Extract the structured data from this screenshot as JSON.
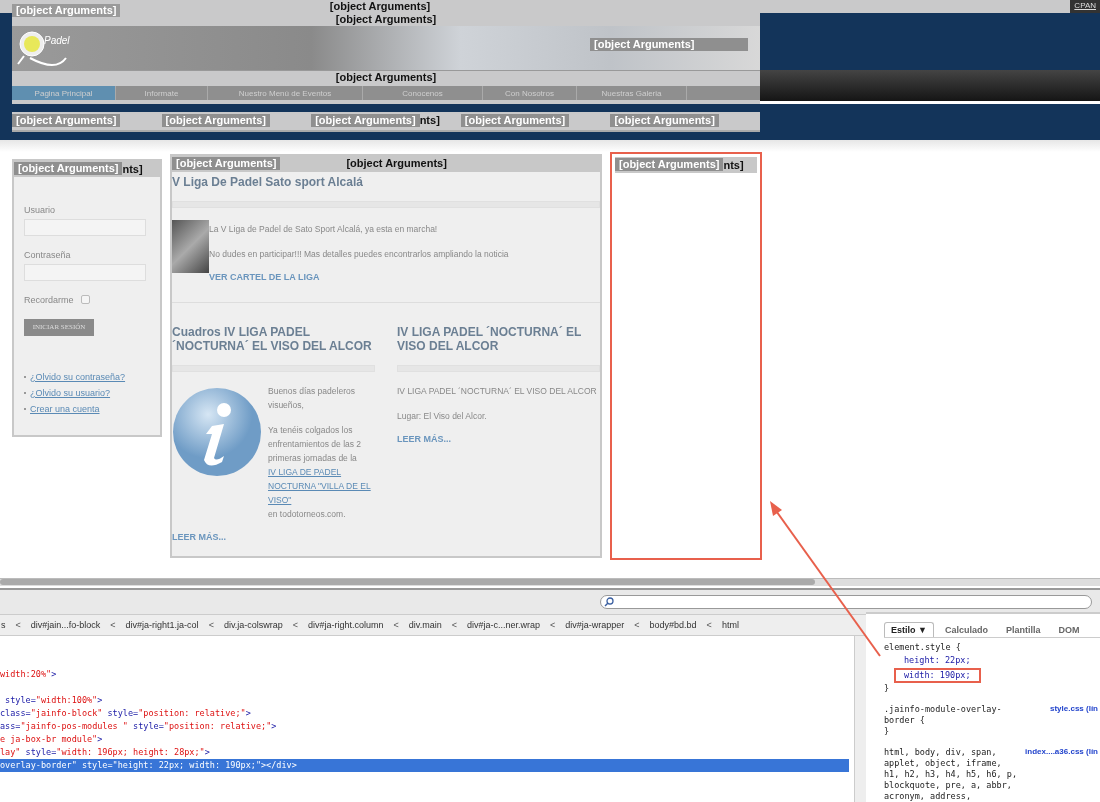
{
  "top_bar": {
    "left_label": "[object Arguments]",
    "center_labels": [
      "[object Arguments]",
      "[object Arguments]"
    ],
    "cpanel_link": "CPAN"
  },
  "banner": {
    "logo_text": "Padel",
    "overlay_label": "[object Arguments]"
  },
  "nav": {
    "overlay_label": "[object Arguments]",
    "items": [
      {
        "label": "Pagina Principal",
        "selected": true
      },
      {
        "label": "Informate",
        "selected": false
      },
      {
        "label": "Nuestro Menú de Eventos",
        "selected": false
      },
      {
        "label": "Conocenos",
        "selected": false
      },
      {
        "label": "Con Nosotros",
        "selected": false
      },
      {
        "label": "Nuestras Galeria",
        "selected": false
      }
    ]
  },
  "module_bar": [
    {
      "label": "[object Arguments]"
    },
    {
      "label": "[object Arguments]"
    },
    {
      "label": "[object Arguments]",
      "tail": "nts]"
    },
    {
      "label": "[object Arguments]"
    },
    {
      "label": "[object Arguments]"
    }
  ],
  "login": {
    "overlay_label": "[object Arguments]",
    "tail": "nts]",
    "username_label": "Usuario",
    "password_label": "Contraseña",
    "remember_label": "Recordarme",
    "remember_checked": false,
    "submit": "INICIAR SESIÓN",
    "links": [
      "¿Olvido su contraseña?",
      "¿Olvido su usuario?",
      "Crear una cuenta"
    ]
  },
  "main": {
    "overlay_label": "[object Arguments]",
    "center_label": "[object Arguments]",
    "lead": {
      "title": "V Liga De Padel Sato sport Alcalá",
      "paragraphs": [
        "La V Liga de Padel de Sato Sport Alcalá, ya esta en marcha!",
        "No dudes en participar!!! Mas detalles puedes encontrarlos ampliando la noticia"
      ],
      "link": "VER CARTEL DE LA LIGA"
    },
    "articles": [
      {
        "kind": "info-image",
        "title": "Cuadros IV LIGA PADEL ´NOCTURNA´ EL VISO DEL ALCOR",
        "paragraphs": [
          [
            {
              "text": "Buenos días padeleros visueños,",
              "kind": "text"
            }
          ],
          [
            {
              "text": "Ya tenéis colgados los enfrentamientos de las 2 primeras jornadas de la",
              "kind": "text"
            },
            {
              "text": "IV LIGA DE PADEL NOCTURNA \"VILLA DE EL VISO\"",
              "kind": "link"
            },
            {
              "text": "en todotorneos.com.",
              "kind": "text"
            }
          ]
        ],
        "more": "LEER MÁS..."
      },
      {
        "kind": "plain",
        "title": "IV LIGA PADEL ´NOCTURNA´ EL VISO DEL ALCOR",
        "paragraphs": [
          [
            {
              "text": "IV LIGA PADEL ´NOCTURNA´ EL VISO DEL ALCOR",
              "kind": "text"
            }
          ],
          [
            {
              "text": "Lugar: El Viso del Alcor.",
              "kind": "text"
            }
          ]
        ],
        "more": "LEER MÁS..."
      }
    ]
  },
  "right_module": {
    "overlay_label": "[object Arguments]",
    "tail": "nts]",
    "highlighted": true
  },
  "devtools": {
    "separator": "<",
    "breadcrumbs": [
      "s",
      "div#jain...fo-block",
      "div#ja-right1.ja-col",
      "div.ja-colswrap",
      "div#ja-right.column",
      "div.main",
      "div#ja-c...ner.wrap",
      "div#ja-wrapper",
      "body#bd.bd",
      "html"
    ],
    "code_lines": [
      {
        "selected": false,
        "segments": [
          {
            "kind": "value",
            "text": "width:20%\""
          },
          {
            "kind": "tag",
            "text": ">"
          }
        ]
      },
      {
        "selected": false,
        "segments": [
          {
            "kind": "tag",
            "text": " style="
          },
          {
            "kind": "value",
            "text": "\"width:100%\""
          },
          {
            "kind": "tag",
            "text": ">"
          }
        ]
      },
      {
        "selected": false,
        "segments": [
          {
            "kind": "tag",
            "text": "class="
          },
          {
            "kind": "value",
            "text": "\"jainfo-block\""
          },
          {
            "kind": "tag",
            "text": " style="
          },
          {
            "kind": "value",
            "text": "\"position: relative;\""
          },
          {
            "kind": "tag",
            "text": ">"
          }
        ]
      },
      {
        "selected": false,
        "segments": [
          {
            "kind": "tag",
            "text": "ass="
          },
          {
            "kind": "value",
            "text": "\"jainfo-pos-modules \""
          },
          {
            "kind": "tag",
            "text": " style="
          },
          {
            "kind": "value",
            "text": "\"position: relative;\""
          },
          {
            "kind": "tag",
            "text": ">"
          }
        ]
      },
      {
        "selected": false,
        "segments": [
          {
            "kind": "value",
            "text": "e ja-box-br module\""
          },
          {
            "kind": "tag",
            "text": ">"
          }
        ]
      },
      {
        "selected": false,
        "segments": [
          {
            "kind": "value",
            "text": "lay\""
          },
          {
            "kind": "tag",
            "text": " style="
          },
          {
            "kind": "value",
            "text": "\"width: 196px; height: 28px;\""
          },
          {
            "kind": "tag",
            "text": ">"
          }
        ]
      },
      {
        "selected": true,
        "segments": [
          {
            "kind": "value",
            "text": "overlay-border\""
          },
          {
            "kind": "tag",
            "text": " style="
          },
          {
            "kind": "value",
            "text": "\"height: 22px; width: 190px;\""
          },
          {
            "kind": "tag",
            "text": "></div>"
          }
        ]
      }
    ],
    "style_tabs": [
      {
        "label": "Estilo",
        "selected": true,
        "dropdown": "▼"
      },
      {
        "label": "Calculado",
        "selected": false
      },
      {
        "label": "Plantilla",
        "selected": false
      },
      {
        "label": "DOM",
        "selected": false
      }
    ],
    "style_rules": [
      {
        "kind": "selector",
        "text": "element.style {"
      },
      {
        "kind": "property",
        "text": "height: 22px;",
        "highlighted": false
      },
      {
        "kind": "property",
        "text": "width: 190px;",
        "highlighted": true
      },
      {
        "kind": "close",
        "text": "}"
      },
      {
        "kind": "selector",
        "text": ".jainfo-module-overlay-border {",
        "source": "style.css (lín"
      },
      {
        "kind": "close",
        "text": "}"
      },
      {
        "kind": "selector",
        "text": "html, body, div, span, applet, object, iframe, h1, h2, h3, h4, h5, h6, p, blockquote, pre, a, abbr, acronym, address,",
        "source": "index....a36.css (lín"
      }
    ]
  }
}
